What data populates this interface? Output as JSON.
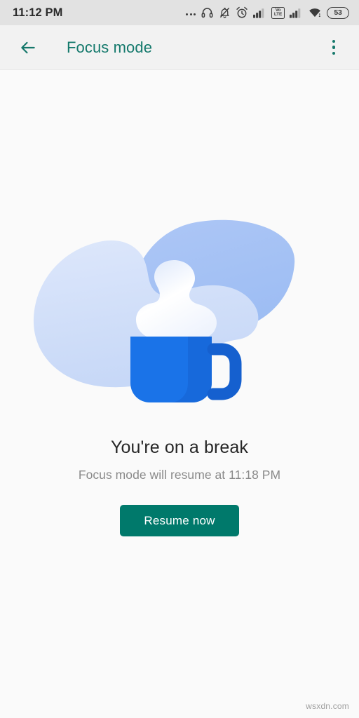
{
  "status_bar": {
    "time": "11:12 PM",
    "battery_level": "53",
    "volte_top": "Vo",
    "volte_bottom": "LTE",
    "icons": [
      "more-notifications-dots-icon",
      "headphones-icon",
      "bell-muted-icon",
      "alarm-clock-icon",
      "signal-bars-sim1-icon",
      "volte-badge-icon",
      "signal-bars-sim2-icon",
      "wifi-icon",
      "battery-icon"
    ]
  },
  "app_bar": {
    "title": "Focus mode",
    "back_icon": "arrow-left-icon",
    "overflow_icon": "more-vertical-icon",
    "accent_color": "#14796c",
    "background_color": "#f2f2f2"
  },
  "main": {
    "illustration_name": "coffee-mug-break-illustration",
    "headline": "You're on a break",
    "subline": "Focus mode will resume at 11:18 PM",
    "resume_button_label": "Resume now",
    "button_color": "#00796b",
    "mug_color": "#1a73e8",
    "mug_shadow_color": "#1558c0",
    "blob_light_color": "#d4e1f9",
    "blob_dark_color": "#a8c4f5",
    "steam_color": "#ffffff",
    "background_color": "#fafafa"
  },
  "watermark": {
    "text": "wsxdn.com"
  }
}
